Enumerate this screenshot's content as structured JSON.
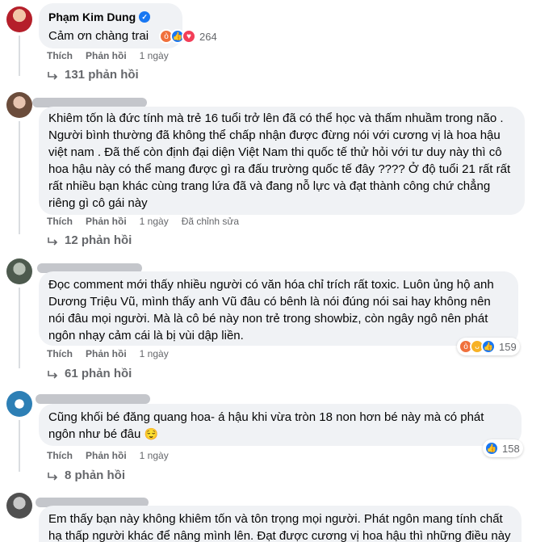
{
  "comments": [
    {
      "author": "Phạm Kim Dung",
      "text": "Cảm ơn chàng trai",
      "like": "Thích",
      "reply": "Phản hồi",
      "time": "1 ngày",
      "edited": "",
      "reaction_count": "264",
      "replies": "131 phản hồi"
    },
    {
      "author": "",
      "text": "Khiêm tốn là đức tính mà trẻ 16 tuổi trở lên đã có thể học và thấm nhuầm trong não . Người bình thường đã không thể chấp nhận được đừng nói với cương vị là hoa hậu việt nam . Đã thế còn định đại diện Việt Nam thi quốc tế thử hỏi với tư duy này thì cô hoa hậu này có thể mang được gì ra đấu trường quốc tế đây ???? Ở độ tuổi 21 rất rất rất nhiều bạn khác cùng trang lứa đã và đang nỗ lực và đạt thành công chứ chẳng riêng gì cô gái này",
      "like": "Thích",
      "reply": "Phản hồi",
      "time": "1 ngày",
      "edited": "Đã chỉnh sửa",
      "reaction_count": "",
      "replies": "12 phản hồi"
    },
    {
      "author": "",
      "text": "Đọc comment mới thấy nhiều người có văn hóa chỉ trích rất toxic. Luôn ủng hộ anh Dương Triệu Vũ, mình thấy anh Vũ đâu có bênh là nói đúng nói sai hay không nên nói đâu mọi người. Mà là cô bé này non trẻ trong showbiz, còn ngây ngô nên phát ngôn nhạy cảm cái là bị vùi dập liền.",
      "like": "Thích",
      "reply": "Phản hồi",
      "time": "1 ngày",
      "edited": "",
      "reaction_count": "159",
      "replies": "61 phản hồi"
    },
    {
      "author": "",
      "text": "Cũng khối bé đăng quang hoa- á hậu khi vừa tròn 18 non hơn bé này mà có phát ngôn như bé đâu",
      "like": "Thích",
      "reply": "Phản hồi",
      "time": "1 ngày",
      "edited": "",
      "reaction_count": "158",
      "replies": "8 phản hồi"
    },
    {
      "author": "",
      "text": "Em thấy bạn này không khiêm tốn và tôn trọng mọi người. Phát ngôn mang tính chất hạ thấp người khác để nâng mình lên. Đạt được cương vị hoa hậu thì những điều này",
      "like": "",
      "reply": "",
      "time": "",
      "edited": "",
      "reaction_count": "",
      "replies": ""
    }
  ],
  "colors": {
    "bubble": "#f0f2f5",
    "meta": "#65676b",
    "like_blue": "#1877f2",
    "angry_orange": "#f0703c",
    "love_red": "#f33e58",
    "haha_yellow": "#f7b125"
  },
  "icons": [
    "verified-badge-icon",
    "angry-reaction-icon",
    "like-reaction-icon",
    "love-reaction-icon",
    "haha-reaction-icon",
    "reply-arrow-icon",
    "relieved-face-emoji"
  ]
}
